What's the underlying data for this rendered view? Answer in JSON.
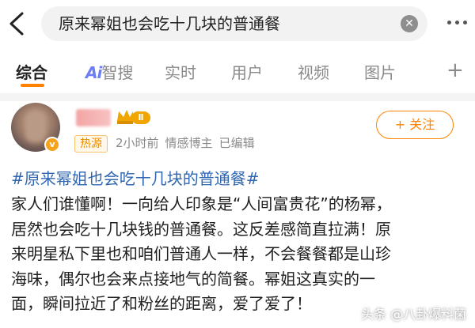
{
  "search": {
    "query": "原来幂姐也会吃十几块的普通餐",
    "clear_icon": "clear-icon"
  },
  "tabs": [
    {
      "label": "综合",
      "active": true
    },
    {
      "label": "智搜",
      "prefix": "Ai"
    },
    {
      "label": "实时"
    },
    {
      "label": "用户"
    },
    {
      "label": "视频"
    },
    {
      "label": "图片"
    }
  ],
  "tab_plus": "+",
  "accent_color": "#ff8200",
  "post": {
    "level": "Ⅱ",
    "verify_mark": "v",
    "source_badge": "热源",
    "time": "2小时前",
    "role": "情感博主",
    "edited": "已编辑",
    "follow_label": "+ 关注",
    "hashtag": "#原来幂姐也会吃十几块的普通餐#",
    "lines": [
      "家人们谁懂啊！一向给人印象是“人间富贵花”的杨幂，",
      "居然也会吃十几块钱的普通餐。这反差感简直拉满！原",
      "来明星私下里也和咱们普通人一样，不会餐餐都是山珍",
      "海味，偶尔也会来点接地气的简餐。幂姐这真实的一",
      "面，瞬间拉近了和粉丝的距离，爱了爱了！"
    ]
  },
  "watermark": "头条 @八卦爆料菌"
}
